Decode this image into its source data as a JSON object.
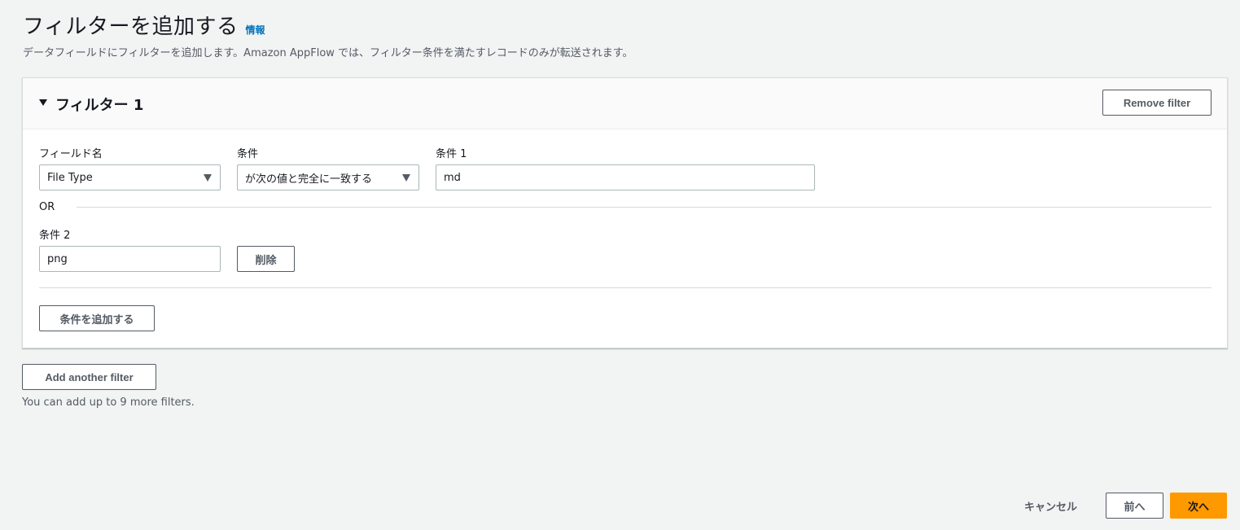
{
  "header": {
    "title": "フィルターを追加する",
    "info_link": "情報",
    "description": "データフィールドにフィルターを追加します。Amazon AppFlow では、フィルター条件を満たすレコードのみが転送されます。"
  },
  "filter": {
    "title": "フィルター 1",
    "remove_button": "Remove filter",
    "field_name_label": "フィールド名",
    "field_name_value": "File Type",
    "condition_label": "条件",
    "condition_value": "が次の値と完全に一致する",
    "value1_label": "条件 1",
    "value1": "md",
    "or_text": "OR",
    "value2_label": "条件 2",
    "value2": "png",
    "delete_button": "削除",
    "add_condition_button": "条件を追加する"
  },
  "add_filter": {
    "button": "Add another filter",
    "helper": "You can add up to 9 more filters."
  },
  "footer": {
    "cancel": "キャンセル",
    "previous": "前へ",
    "next": "次へ"
  },
  "colors": {
    "accent": "#ff9900",
    "link": "#0073bb",
    "background": "#f2f3f3"
  }
}
